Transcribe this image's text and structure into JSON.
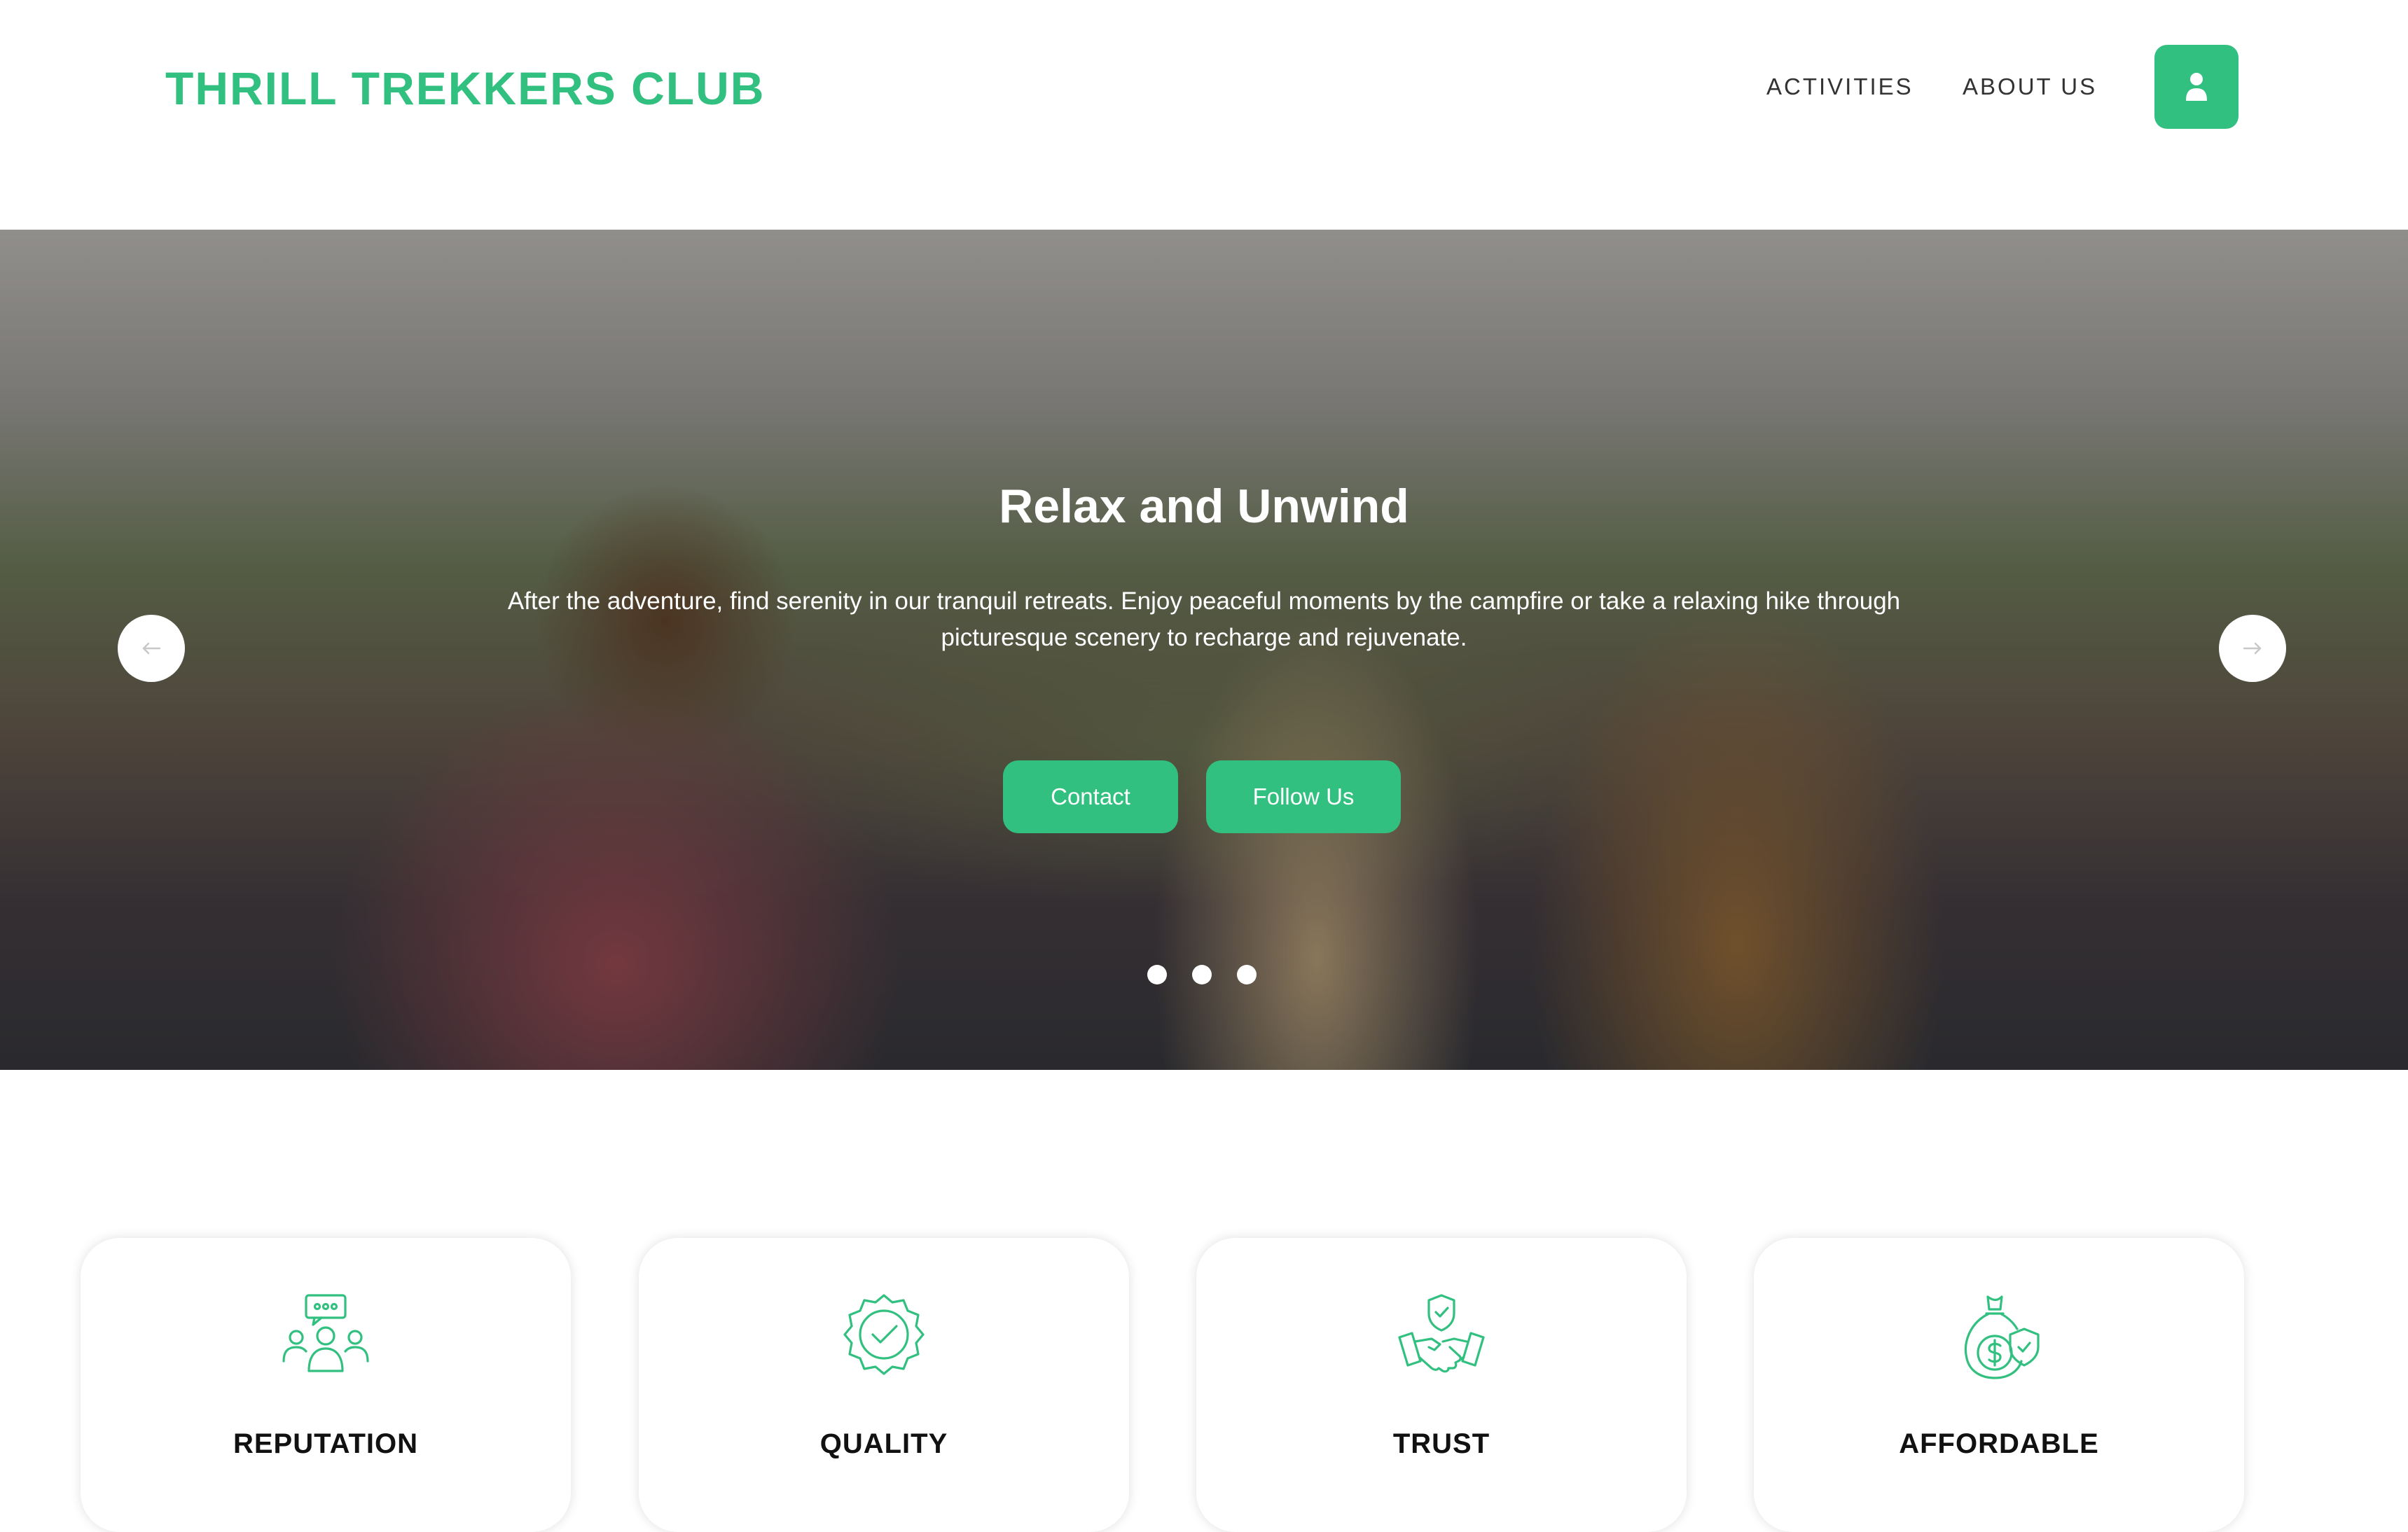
{
  "header": {
    "brand": "THRILL TREKKERS CLUB",
    "nav": {
      "activities": "ACTIVITIES",
      "about": "ABOUT US"
    },
    "account_icon": "user-icon"
  },
  "hero": {
    "title": "Relax and Unwind",
    "description": "After the adventure, find serenity in our tranquil retreats. Enjoy peaceful moments by the campfire or take a relaxing hike through picturesque scenery to recharge and rejuvenate.",
    "buttons": {
      "contact": "Contact",
      "follow": "Follow Us"
    },
    "prev_icon": "arrow-left-icon",
    "next_icon": "arrow-right-icon",
    "slide_count": 3
  },
  "features": [
    {
      "title": "REPUTATION",
      "icon": "community-chat-icon"
    },
    {
      "title": "QUALITY",
      "icon": "quality-badge-icon"
    },
    {
      "title": "TRUST",
      "icon": "handshake-shield-icon"
    },
    {
      "title": "AFFORDABLE",
      "icon": "money-bag-shield-icon"
    }
  ],
  "colors": {
    "accent": "#31c07f",
    "text": "#111111",
    "nav_text": "#333333"
  }
}
